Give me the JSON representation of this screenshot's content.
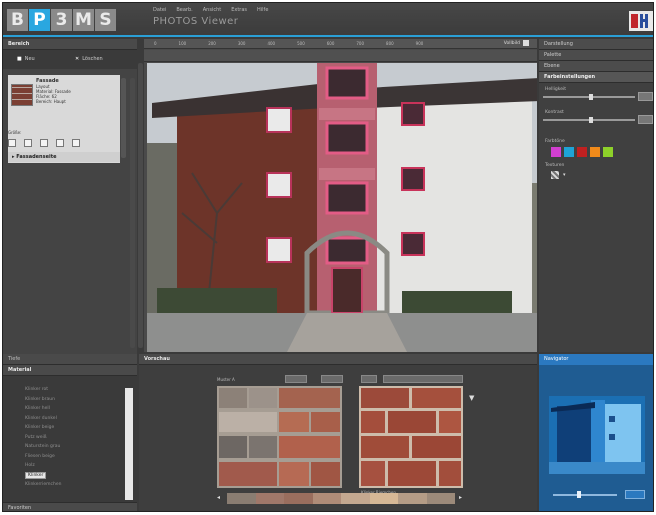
{
  "app": {
    "logo_letters": [
      "B",
      "P",
      "3",
      "M",
      "S"
    ],
    "highlighted_letter_index": 1,
    "title": "PHOTOS Viewer",
    "menu": [
      "Datei",
      "Bearb.",
      "Ansicht",
      "Extras",
      "Hilfe"
    ]
  },
  "left_panel": {
    "title": "Bereich",
    "btn_new": "Neu",
    "btn_delete": "Löschen",
    "item_title": "Fassade",
    "item_lines": [
      "Layout",
      "Material: Fassade",
      "Fläche: 62",
      "Bereich: Haupt"
    ],
    "option_label": "Größe:",
    "item2_title": "Fassadenseite"
  },
  "viewer": {
    "zoom_label": "Vollbild",
    "ruler_ticks": [
      "0",
      "100",
      "200",
      "300",
      "400",
      "500",
      "600",
      "700",
      "800",
      "900"
    ]
  },
  "right_panel": {
    "tabs": [
      "Darstellung",
      "Palette",
      "Ebene"
    ],
    "section": "Farbeinstellungen",
    "slider1_label": "Helligkeit",
    "slider2_label": "Kontrast",
    "colors_label": "Farbtöne",
    "colors": [
      "#d23fd0",
      "#1ea3d6",
      "#c02020",
      "#f08a1a",
      "#8ed12a"
    ],
    "texture_label": "Texturen"
  },
  "bottom_left": {
    "tab1": "Tiefe",
    "tab2": "Material",
    "materials": [
      "Klinker rot",
      "Klinker braun",
      "Klinker hell",
      "Klinker dunkel",
      "Klinker beige",
      "Putz weiß",
      "Naturstein grau",
      "Fliesen beige",
      "Holz",
      "Klinker",
      "Klinkerriemchen"
    ],
    "selected_index": 9,
    "footer": "Favoriten"
  },
  "bottom_mid": {
    "title": "Vorschau",
    "swatch1_label": "Muster A",
    "swatch2_label": "Klinker",
    "swatch2_caption": "Klinker Riemchen",
    "palette_colors": [
      "#8a7d72",
      "#a0786a",
      "#9a6e5e",
      "#b08c78",
      "#c4a890",
      "#d6b896",
      "#b49c86",
      "#9c8a7a"
    ]
  },
  "bottom_right": {
    "title": "Navigator"
  }
}
